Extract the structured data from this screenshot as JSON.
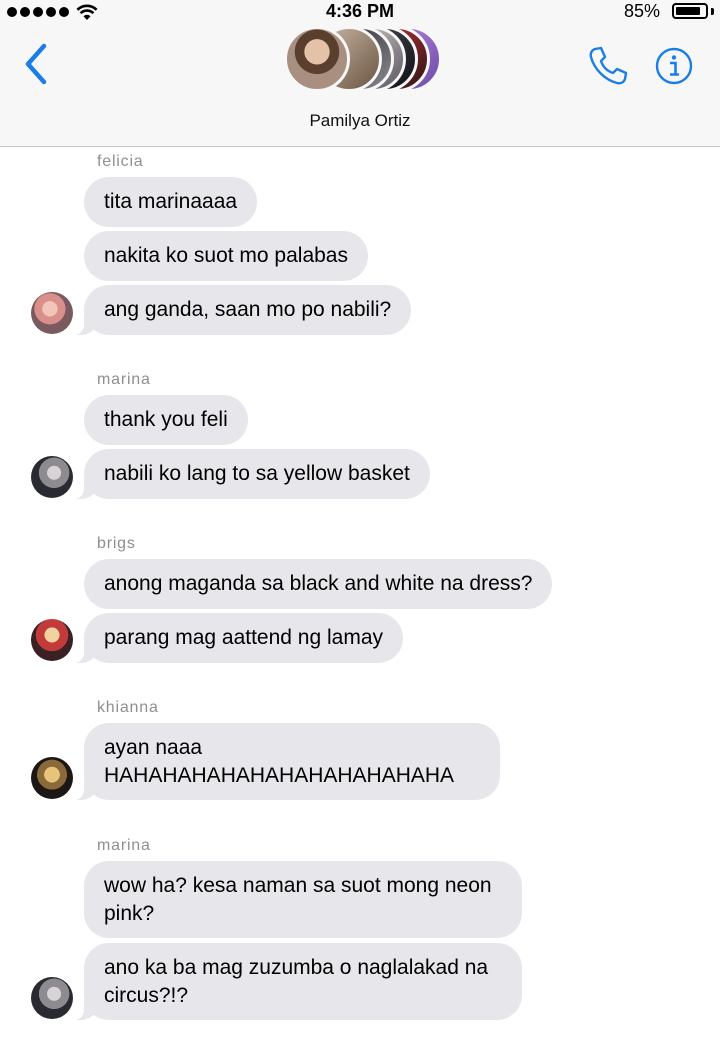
{
  "status_bar": {
    "time": "4:36 PM",
    "battery_percent": "85%",
    "battery_level": 0.85,
    "icons": [
      "signal-dots-icon",
      "wifi-icon",
      "battery-icon"
    ]
  },
  "header": {
    "group_name": "Pamilya Ortiz",
    "icons": [
      "back-chevron-icon",
      "phone-icon",
      "info-icon"
    ],
    "accent_color": "#1a7ee6"
  },
  "messages": [
    {
      "sender": "felicia",
      "bubbles": [
        "tita marinaaaa",
        "nakita ko suot mo palabas",
        "ang ganda, saan mo po nabili?"
      ]
    },
    {
      "sender": "marina",
      "bubbles": [
        "thank you feli",
        "nabili ko lang to sa yellow basket"
      ]
    },
    {
      "sender": "brigs",
      "bubbles": [
        "anong maganda sa black and white na dress?",
        "parang mag aattend ng lamay"
      ]
    },
    {
      "sender": "khianna",
      "bubbles": [
        "ayan naaa HAHAHAHAHAHAHAHAHAHAHAHA"
      ]
    },
    {
      "sender": "marina",
      "bubbles": [
        "wow ha? kesa naman sa suot mong neon pink?",
        "ano ka ba mag zuzumba o naglalakad na circus?!?"
      ]
    }
  ],
  "colors": {
    "incoming_bubble": "#e6e6eb",
    "sender_label": "#8e8e93",
    "bar_background": "#f7f7f8"
  }
}
